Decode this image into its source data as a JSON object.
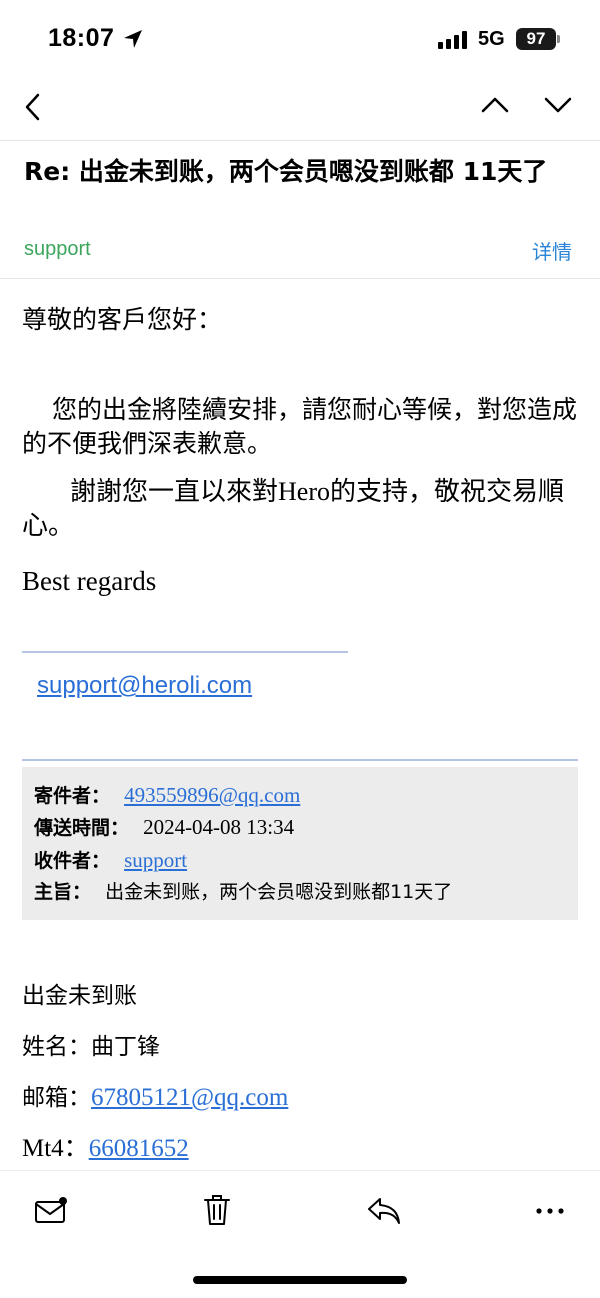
{
  "status": {
    "time": "18:07",
    "network": "5G",
    "battery": "97"
  },
  "nav": {
    "back": "back",
    "prev": "previous-message",
    "next": "next-message"
  },
  "email": {
    "subject": "Re: 出金未到账，两个会员嗯没到账都 11天了",
    "sender": "support",
    "details_label": "详情",
    "greeting": "尊敬的客戶您好：",
    "para1": "您的出金將陸續安排，請您耐心等候，對您造成的不便我們深表歉意。",
    "para2": "謝謝您一直以來對Hero的支持，敬祝交易順心。",
    "regards": "Best regards",
    "signature_email": "support@heroli.com"
  },
  "quoted": {
    "from_label": "寄件者：",
    "from_value": "493559896@qq.com",
    "sent_label": "傳送時間：",
    "sent_value": "2024-04-08 13:34",
    "to_label": "收件者：",
    "to_value": "support",
    "subject_label": "主旨：",
    "subject_value": "出金未到账，两个会员嗯没到账都11天了"
  },
  "original": {
    "line1": "出金未到账",
    "name_label": "姓名：",
    "name_value": "曲丁锋",
    "email_label": "邮箱：",
    "email_value": "67805121@qq.com",
    "mt4_label": "Mt4：",
    "mt4_value": "66081652"
  },
  "toolbar": {
    "icons": [
      "mail-unread-icon",
      "trash-icon",
      "reply-icon",
      "more-icon"
    ]
  },
  "colors": {
    "sender": "#3ba55c",
    "link": "#2a6fd6",
    "accent": "#2a84d9"
  }
}
